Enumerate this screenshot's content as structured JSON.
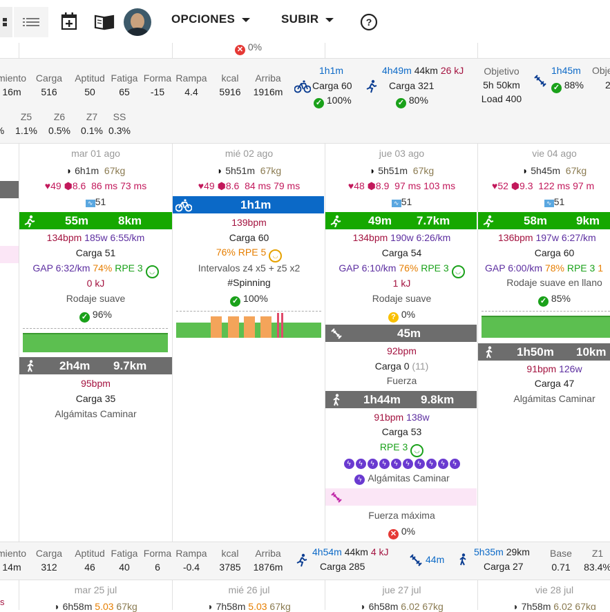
{
  "toolbar": {
    "opciones_label": "OPCIONES",
    "subir_label": "SUBIR"
  },
  "top_partial": {
    "fail_pct": "0%"
  },
  "week1": {
    "labels": [
      "miento",
      "Carga",
      "Aptitud",
      "Fatiga",
      "Forma",
      "Rampa",
      "kcal",
      "Arriba"
    ],
    "values": [
      "16m",
      "516",
      "50",
      "65",
      "-15",
      "4.4",
      "5916",
      "1916m"
    ],
    "bike": {
      "time": "1h1m",
      "load": "Carga 60",
      "compliance": "100%"
    },
    "run": {
      "time": "4h49m",
      "dist": "44km",
      "kj": "26 kJ",
      "load": "Carga 321",
      "compliance": "80%"
    },
    "objetivo": {
      "label": "Objetivo",
      "time": "5h 50km",
      "load": "Load 400"
    },
    "strength": {
      "time": "1h45m",
      "compliance": "88%",
      "label_partial": "Obje",
      "value_partial": "2"
    },
    "zones_labels": [
      "Z5",
      "Z6",
      "Z7",
      "SS"
    ],
    "zones_values": [
      "%",
      "1.1%",
      "0.5%",
      "0.1%",
      "0.3%"
    ]
  },
  "days": [
    {
      "date": "mar 01 ago",
      "sleep": "6h1m",
      "weight": "67kg",
      "hr": "49",
      "hrv_score": "8.6",
      "hrv1": "86 ms",
      "hrv2": "73 ms",
      "stress": "51",
      "act1": {
        "time": "55m",
        "dist": "8km",
        "bpm": "134bpm",
        "watts": "185w",
        "pace": "6:55/km",
        "load": "Carga 51",
        "gap": "GAP 6:32/km",
        "effort": "74%",
        "rpe": "RPE 3",
        "kj": "0 kJ",
        "name": "Rodaje suave",
        "compliance": "96%"
      },
      "act2": {
        "time": "2h4m",
        "dist": "9.7km",
        "bpm": "95bpm",
        "load": "Carga 35",
        "name": "Algámitas Caminar"
      }
    },
    {
      "date": "mié 02 ago",
      "sleep": "5h51m",
      "weight": "67kg",
      "hr": "49",
      "hrv_score": "8.6",
      "hrv1": "84 ms",
      "hrv2": "79 ms",
      "act1": {
        "time": "1h1m",
        "bpm": "139bpm",
        "load": "Carga 60",
        "effort": "76%",
        "rpe": "RPE 5",
        "desc": "Intervalos z4 x5 + z5 x2",
        "tag": "#Spinning",
        "compliance": "100%"
      }
    },
    {
      "date": "jue 03 ago",
      "sleep": "5h51m",
      "weight": "67kg",
      "hr": "48",
      "hrv_score": "8.9",
      "hrv1": "97 ms",
      "hrv2": "103 ms",
      "stress": "51",
      "act1": {
        "time": "49m",
        "dist": "7.7km",
        "bpm": "134bpm",
        "watts": "190w",
        "pace": "6:26/km",
        "load": "Carga 54",
        "gap": "GAP 6:10/km",
        "effort": "76%",
        "rpe": "RPE 3",
        "kj": "1 kJ",
        "name": "Rodaje suave",
        "compliance": "0%"
      },
      "act2": {
        "time": "45m",
        "bpm": "92bpm",
        "load": "Carga 0",
        "load_extra": "(11)",
        "name": "Fuerza"
      },
      "act3": {
        "time": "1h44m",
        "dist": "9.8km",
        "bpm": "91bpm",
        "watts": "138w",
        "load": "Carga 53",
        "rpe": "RPE 3",
        "name": "Algámitas Caminar"
      },
      "act4": {
        "name": "Fuerza máxima",
        "compliance": "0%"
      }
    },
    {
      "date": "vie 04 ago",
      "sleep": "5h45m",
      "weight": "67kg",
      "hr": "52",
      "hrv_score": "9.3",
      "hrv1": "122 ms",
      "hrv2": "97 m",
      "stress": "51",
      "act1": {
        "time": "58m",
        "dist": "9km",
        "bpm": "136bpm",
        "watts": "197w",
        "pace": "6:27/km",
        "load": "Carga 60",
        "gap": "GAP 6:00/km",
        "effort": "78%",
        "rpe": "RPE 3",
        "extra": "1",
        "name": "Rodaje suave en llano",
        "compliance": "85%"
      },
      "act2": {
        "time": "1h50m",
        "dist": "10km",
        "bpm": "91bpm",
        "watts": "126w",
        "load": "Carga 47",
        "name": "Algámitas Caminar"
      }
    }
  ],
  "week2": {
    "labels": [
      "miento",
      "Carga",
      "Aptitud",
      "Fatiga",
      "Forma",
      "Rampa",
      "kcal",
      "Arriba"
    ],
    "values": [
      "14m",
      "312",
      "46",
      "40",
      "6",
      "-0.4",
      "3785",
      "1876m"
    ],
    "run": {
      "time": "4h54m",
      "dist": "44km",
      "kj": "4 kJ",
      "load": "Carga 285"
    },
    "strength": {
      "time": "44m"
    },
    "walk": {
      "time": "5h35m",
      "dist": "29km",
      "load": "Carga 27"
    },
    "base": {
      "label": "Base",
      "value": "0.71"
    },
    "z1": {
      "label": "Z1",
      "value": "83.4%"
    }
  },
  "days2": [
    {
      "date": "mar 25 jul",
      "sleep": "6h58m",
      "hrv": "5.03",
      "weight": "67kg"
    },
    {
      "date": "mié 26 jul",
      "sleep": "7h58m",
      "hrv": "5.03",
      "weight": "67kg"
    },
    {
      "date": "jue 27 jul",
      "sleep": "6h58m",
      "hrv": "6.02",
      "weight": "67kg"
    },
    {
      "date": "vie 28 jul",
      "sleep": "7h58m",
      "hrv": "6.02",
      "weight": "67kg"
    }
  ],
  "left_partial": {
    "s_char": "s"
  }
}
